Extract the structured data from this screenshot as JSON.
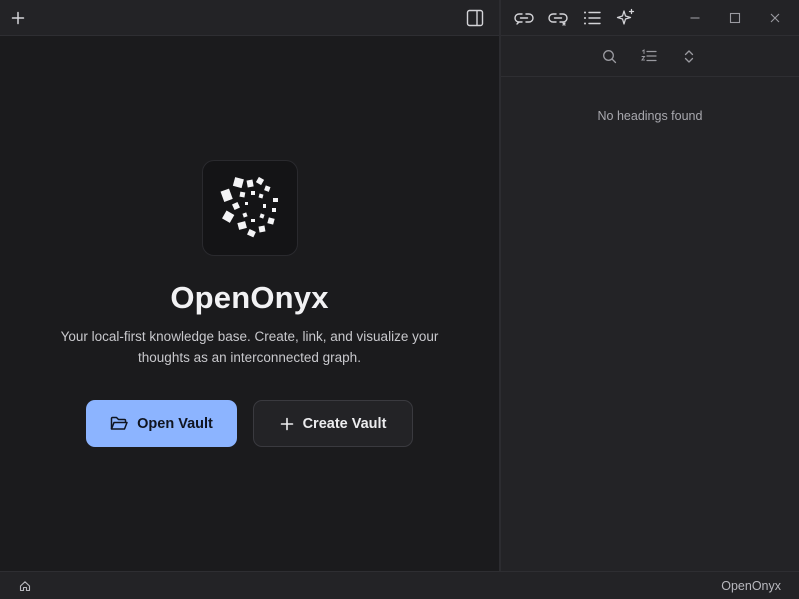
{
  "app": {
    "name": "OpenOnyx",
    "tagline": "Your local-first knowledge base. Create, link, and visualize your thoughts as an interconnected graph."
  },
  "toolbar": {
    "icons": [
      "plus-icon",
      "sidebar-toggle-icon",
      "link-icon",
      "unlink-icon",
      "list-icon",
      "sparkles-icon",
      "minimize-icon",
      "maximize-icon",
      "close-icon"
    ]
  },
  "actions": {
    "open_vault": "Open Vault",
    "create_vault": "Create Vault"
  },
  "outline": {
    "empty_message": "No headings found",
    "toolbar_icons": [
      "search-icon",
      "ordered-list-icon",
      "expand-collapse-icon"
    ]
  },
  "statusbar": {
    "app_name": "OpenOnyx",
    "icon": "home-icon"
  },
  "colors": {
    "accent": "#8cb4ff",
    "background": "#1b1b1d",
    "panel": "#232326"
  }
}
